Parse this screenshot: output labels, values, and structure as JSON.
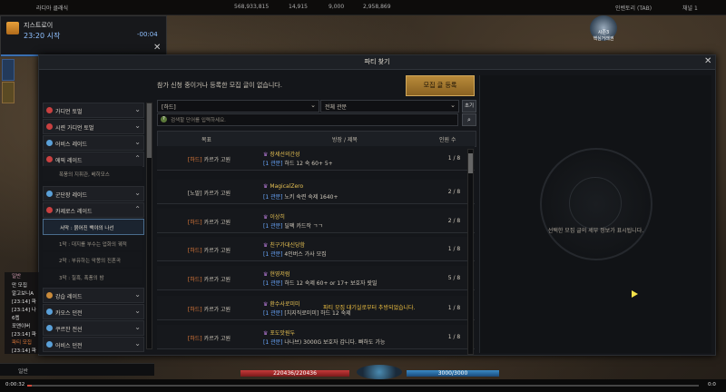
{
  "top": {
    "title": "라디아 클래식",
    "resources": [
      "568,933,815",
      "14,915",
      "9,000",
      "2,958,869"
    ],
    "right": [
      "인벤토리 (TAB)",
      "채널 1"
    ]
  },
  "notification": {
    "name": "지스트로이",
    "time": "23:20 시작",
    "countdown": "-00:04",
    "close": "✕"
  },
  "season": {
    "label1": "시즌3",
    "label2": "핵심거래권"
  },
  "window": {
    "title": "파티 찾기",
    "close": "✕",
    "notice": "참가 신청 중이거나 등록한 모집 글이 없습니다.",
    "register": "모집 글 등록",
    "filter1": "[하드]",
    "filter2": "전체 관문",
    "reset": "초기화",
    "search_placeholder": "검색할 단어를 입력하세요.",
    "columns": {
      "goal": "목표",
      "title": "방장 / 제목",
      "members": "인원 수"
    },
    "detail_msg": "선택한 모집 글의 세부 정보가 표시됩니다."
  },
  "categories": [
    {
      "label": "가디언 토벌",
      "color": "#c94040",
      "top": 0
    },
    {
      "label": "시련 가디언 토벌",
      "color": "#c94040"
    },
    {
      "label": "어비스 레이드",
      "color": "#5aa0d8"
    },
    {
      "label": "에픽 레이드",
      "color": "#c94040",
      "expanded": true
    },
    {
      "label": "군단장 레이드",
      "color": "#5aa0d8"
    },
    {
      "label": "카제로스 레이드",
      "color": "#c94040",
      "expanded": true
    },
    {
      "label": "강습 레이드",
      "color": "#c98a3a"
    },
    {
      "label": "카오스 던전",
      "color": "#5aa0d8"
    },
    {
      "label": "쿠르잔 전선",
      "color": "#5aa0d8"
    },
    {
      "label": "어비스 던전",
      "color": "#5aa0d8"
    }
  ],
  "subitems": {
    "epic": [
      "폭풍의 지휘관, 베히모스"
    ],
    "kazeros": [
      "서막 : 붉어진 백야의 나선",
      "1막 : 대지를 부수는 업화의 궤적",
      "2막 : 부유하는 악몽의 진혼곡",
      "3막 : 칠흑, 폭풍의 밤"
    ]
  },
  "rows": [
    {
      "tag": "[하드]",
      "goal": "카르가 고원",
      "host": "장세선의간성",
      "level": "[1 관문]",
      "desc": "하드 12 숙 60+ 5+",
      "members": "1 / 8"
    },
    {
      "tag": "[노말]",
      "goal": "카르가 고원",
      "host": "MagicalZero",
      "level": "[1 관문]",
      "desc": "노키 숙련 숙제 1640+",
      "members": "2 / 8"
    },
    {
      "tag": "[하드]",
      "goal": "카르가 고원",
      "host": "이상히",
      "level": "[1 관문]",
      "desc": "딜팩 카드작 ㄱㄱ",
      "members": "2 / 8"
    },
    {
      "tag": "[하드]",
      "goal": "카르가 고원",
      "host": "친구가대신당함",
      "level": "[1 관문]",
      "desc": "4인버스 가사 모집",
      "members": "1 / 8"
    },
    {
      "tag": "[하드]",
      "goal": "카르가 고원",
      "host": "현영저럼",
      "level": "[1 관문]",
      "desc": "하드 12 숙제 60+ or 17+ 보호자 랏밀",
      "members": "5 / 8"
    },
    {
      "tag": "[하드]",
      "goal": "카르가 고원",
      "host": "환수사로미미",
      "level": "[1 관문]",
      "desc": "[치지직로미미] 하드 12 숙제",
      "members": "1 / 8",
      "alert": "파티 모집 대기실로부터 추방되었습니다."
    },
    {
      "tag": "[하드]",
      "goal": "카르가 고원",
      "host": "포도맛원두",
      "level": "[1 관문]",
      "desc": "나나브) 3000G 보호자 갑니다. 빠하도 가능",
      "members": "1 / 8"
    }
  ],
  "chat": {
    "tab": "일반",
    "lines": [
      "만 모집",
      "알고보니A",
      "[23:14] 파",
      "[23:14] 나",
      "6렙",
      "포맨이버",
      "[23:14] 파",
      "파티 모집",
      "[23:14] 파"
    ],
    "input_label": "일반"
  },
  "hp": "220436/220436",
  "mp": "3000/3000",
  "video": {
    "current": "0:00:32",
    "end": "0:0"
  }
}
